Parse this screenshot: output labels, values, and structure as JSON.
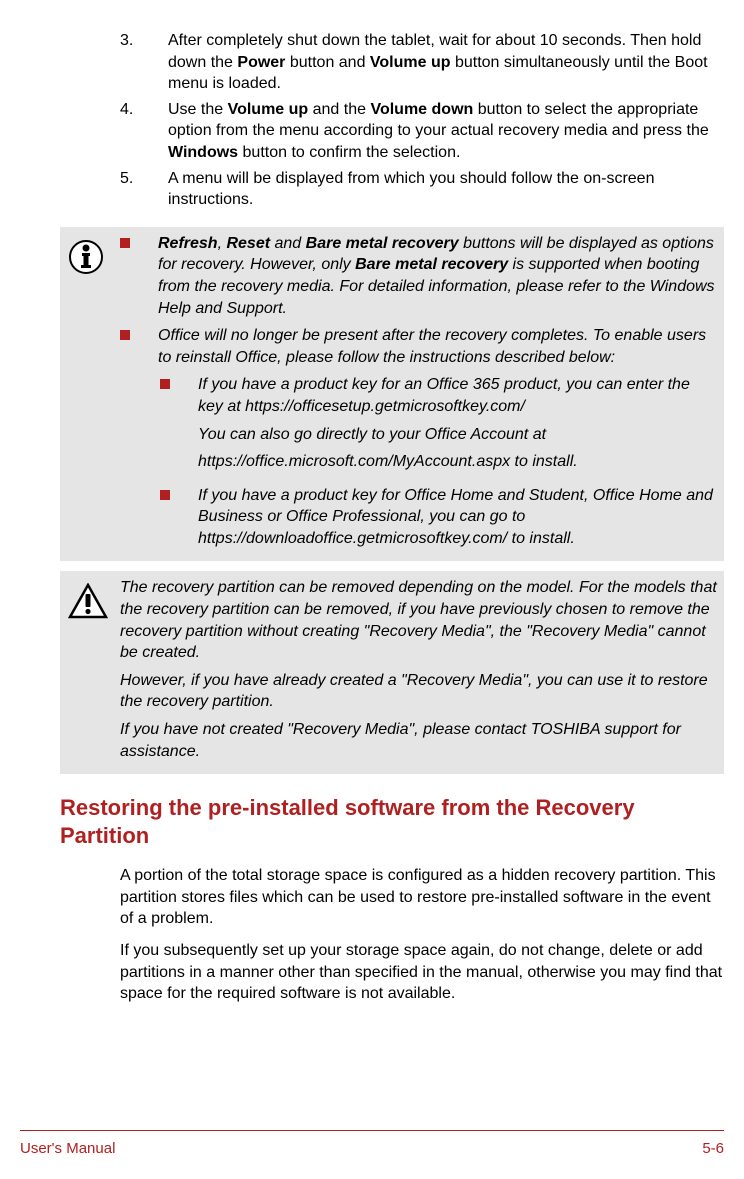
{
  "ol": {
    "items": [
      {
        "num": "3.",
        "html": "After completely shut down the tablet, wait for about 10 seconds. Then hold down the <b>Power</b> button and <b>Volume up</b> button simultaneously until the Boot menu is loaded."
      },
      {
        "num": "4.",
        "html": "Use the <b>Volume up</b> and the <b>Volume down</b> button to select the appropriate option from the menu according to your actual recovery media and press the <b>Windows</b> button to confirm the selection."
      },
      {
        "num": "5.",
        "html": "A menu will be displayed from which you should follow the on-screen instructions."
      }
    ]
  },
  "info_callout": {
    "bullets": [
      {
        "html": "<b>Refresh</b>, <b>Reset</b> and <b>Bare metal recovery</b> buttons will be displayed as options for recovery. However, only <b>Bare metal recovery</b> is supported when booting from the recovery media. For detailed information, please refer to the Windows Help and Support."
      },
      {
        "html": "Office will no longer be present after the recovery completes. To enable users to reinstall Office, please follow the instructions described below:"
      }
    ],
    "sub_bullets": [
      {
        "html": "If you have a product key for an Office 365 product, you can enter the key at https://officesetup.getmicrosoftkey.com/",
        "extra": [
          "You can also go directly to your Office Account at",
          "https://office.microsoft.com/MyAccount.aspx to install."
        ]
      },
      {
        "html": "If you have a product key for Office Home and Student, Office Home and Business or Office Professional, you can go to https://downloadoffice.getmicrosoftkey.com/ to install."
      }
    ]
  },
  "warning_callout": {
    "paras": [
      "The recovery partition can be removed depending on the model. For the models that the recovery partition can be removed, if you have previously chosen to remove the recovery partition without creating \"Recovery Media\", the \"Recovery Media\" cannot be created.",
      "However, if you have already created a \"Recovery Media\", you can use it to restore the recovery partition.",
      "If you have not created \"Recovery Media\", please contact TOSHIBA support for assistance."
    ]
  },
  "section": {
    "heading": "Restoring the pre-installed software from the Recovery Partition",
    "paras": [
      "A portion of the total storage space is configured as a hidden recovery partition. This partition stores files which can be used to restore pre-installed software in the event of a problem.",
      "If you subsequently set up your storage space again, do not change, delete or add partitions in a manner other than specified in the manual, otherwise you may find that space for the required software is not available."
    ]
  },
  "footer": {
    "left": "User's Manual",
    "right": "5-6"
  }
}
